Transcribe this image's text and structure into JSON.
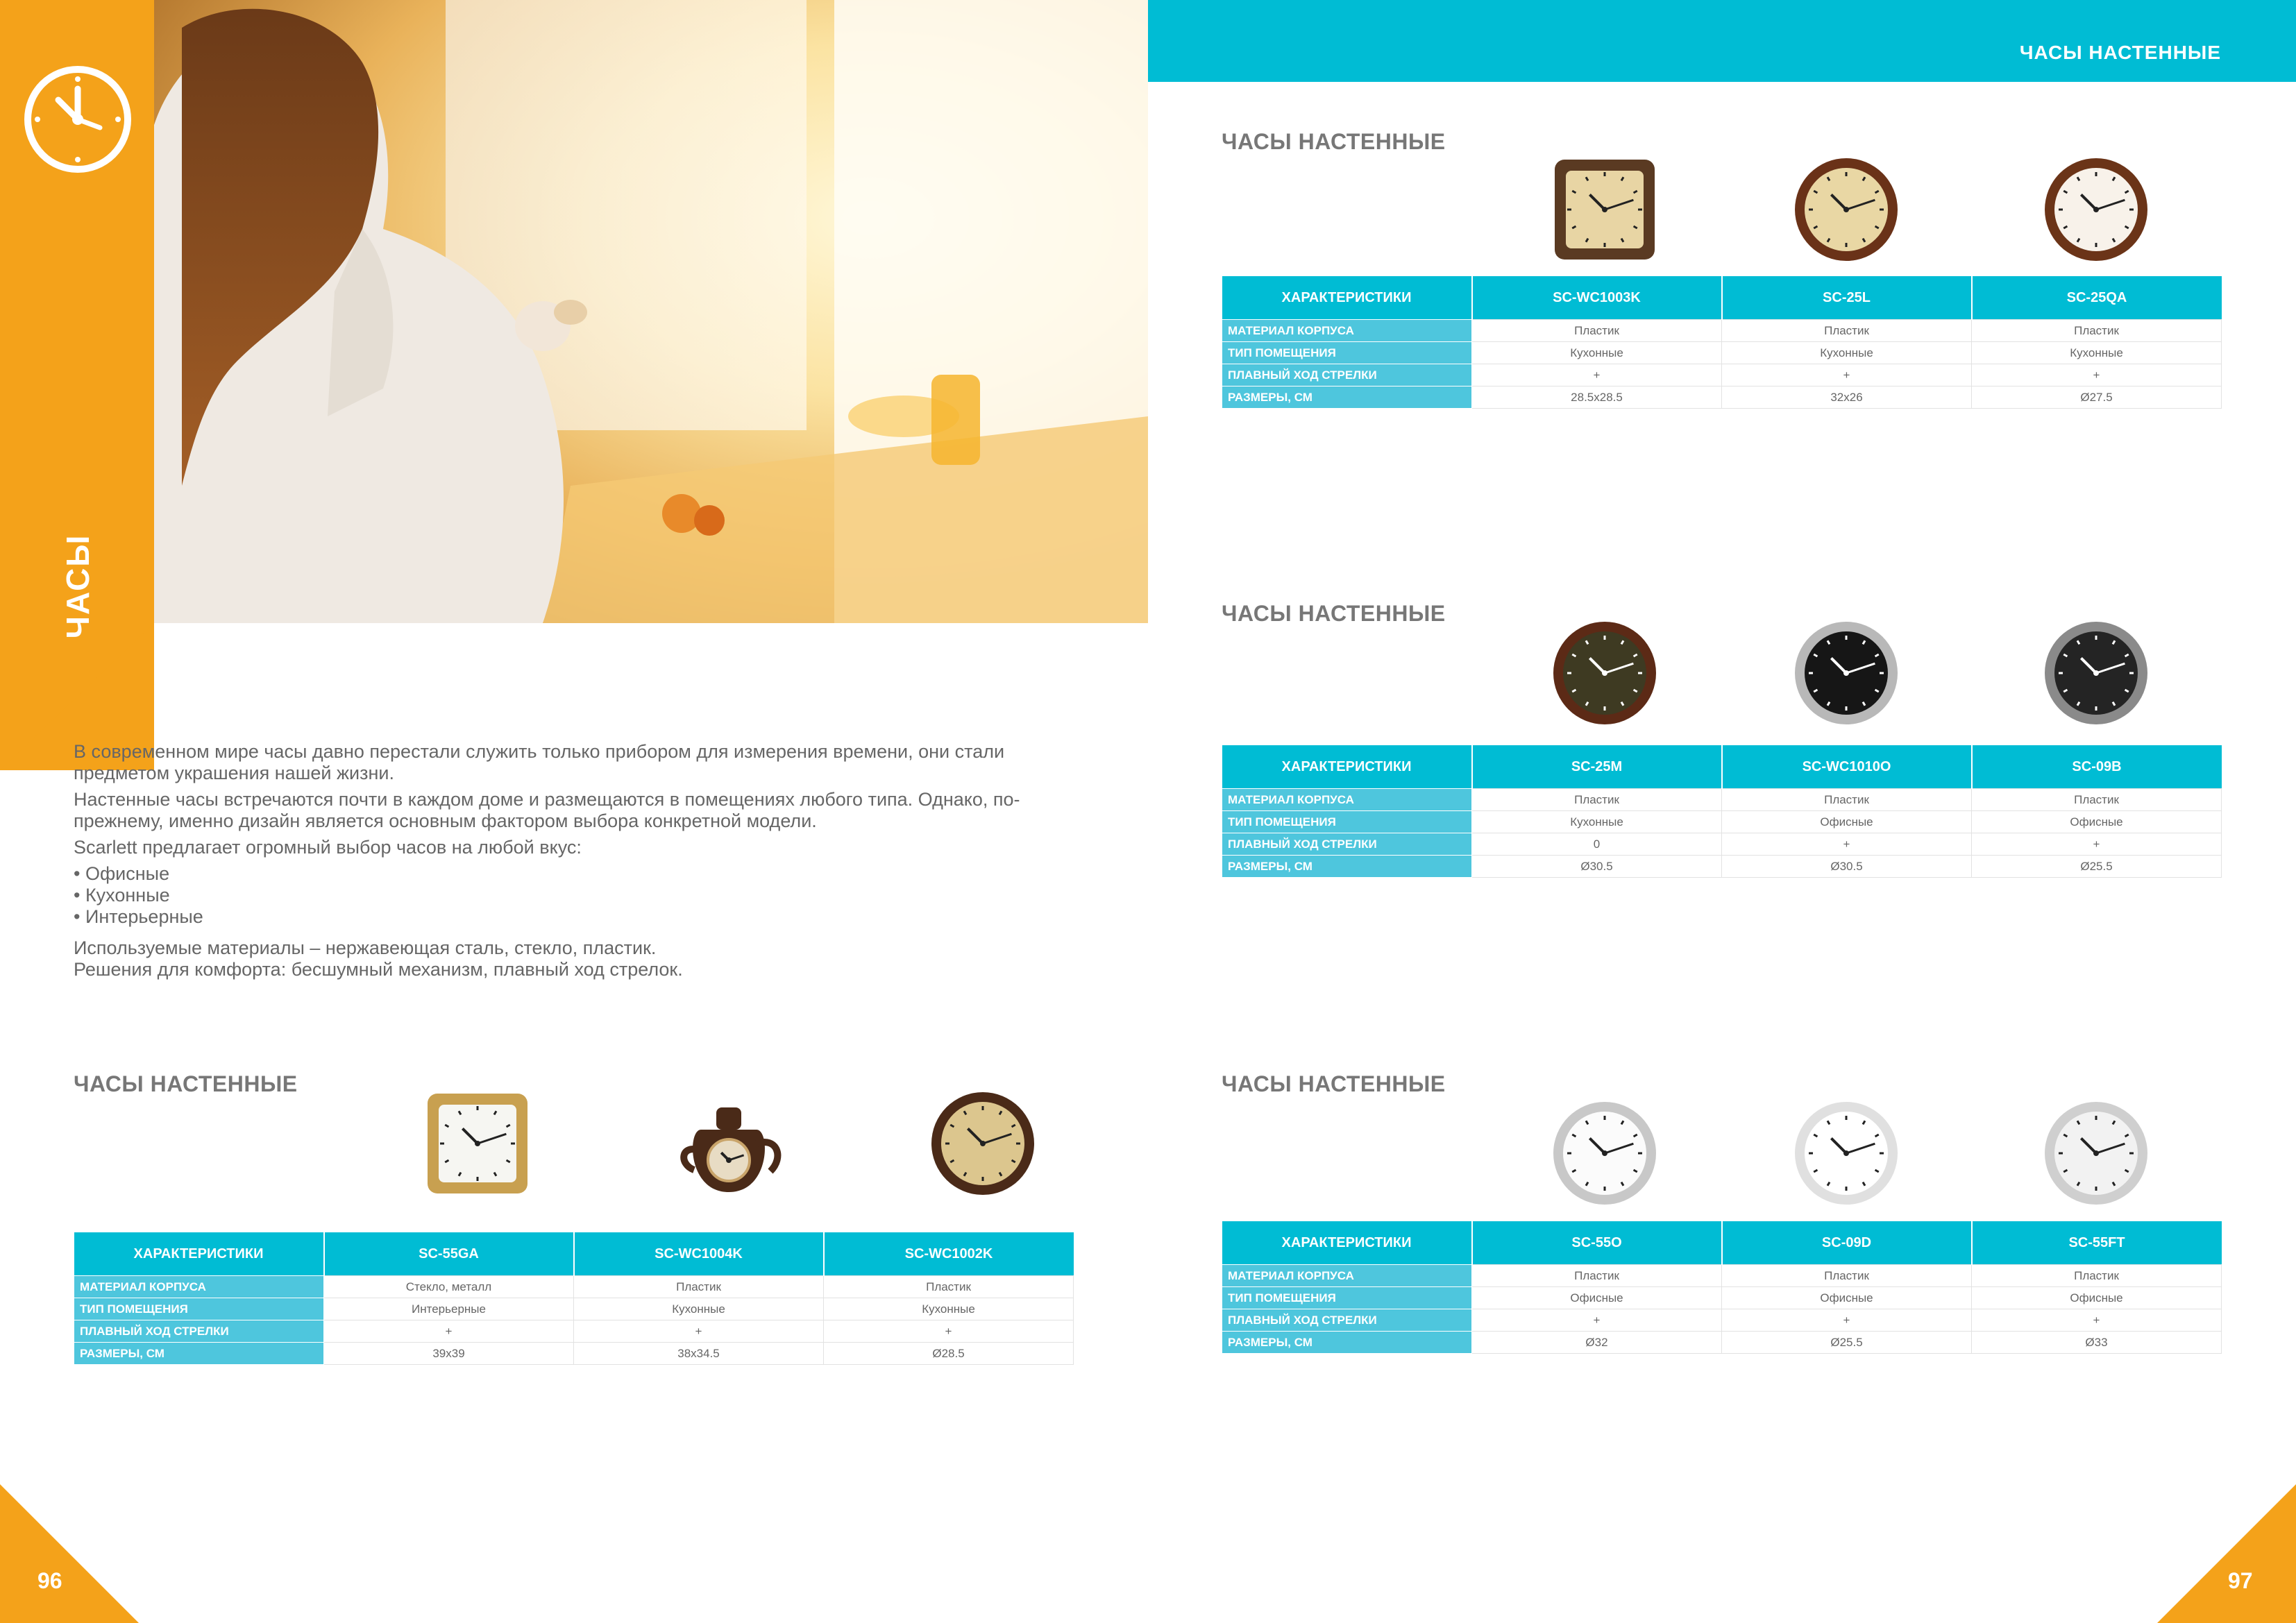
{
  "side": {
    "section_label": "ЧАСЫ"
  },
  "top_bar": {
    "title": "ЧАСЫ НАСТЕННЫЕ"
  },
  "intro": {
    "paragraph1": "В современном мире часы давно перестали служить только прибором для измерения времени, они стали предметом украшения нашей жизни.",
    "paragraph2": "Настенные часы встречаются почти в каждом доме и размещаются в помещениях любого типа. Однако, по-прежнему, именно дизайн является основным фактором выбора конкретной модели.",
    "paragraph3": "Scarlett предлагает огромный выбор часов на любой вкус:",
    "bullets": [
      "• Офисные",
      "• Кухонные",
      "• Интерьерные"
    ],
    "paragraph4": "Используемые материалы – нержавеющая сталь, стекло, пластик.",
    "paragraph5": "Решения для комфорта: бесшумный механизм, плавный ход стрелок."
  },
  "row_labels": [
    "МАТЕРИАЛ КОРПУСА",
    "ТИП ПОМЕЩЕНИЯ",
    "ПЛАВНЫЙ ХОД СТРЕЛКИ",
    "РАЗМЕРЫ, СМ"
  ],
  "blocks": [
    {
      "title": "ЧАСЫ НАСТЕННЫЕ",
      "header": "ХАРАКТЕРИСТИКИ",
      "models": [
        "SC-WC1003K",
        "SC-25L",
        "SC-25QA"
      ],
      "rows": [
        [
          "Пластик",
          "Пластик",
          "Пластик"
        ],
        [
          "Кухонные",
          "Кухонные",
          "Кухонные"
        ],
        [
          "+",
          "+",
          "+"
        ],
        [
          "28.5x28.5",
          "32x26",
          "Ø27.5"
        ]
      ]
    },
    {
      "title": "ЧАСЫ НАСТЕННЫЕ",
      "header": "ХАРАКТЕРИСТИКИ",
      "models": [
        "SC-25M",
        "SC-WC1010O",
        "SC-09B"
      ],
      "rows": [
        [
          "Пластик",
          "Пластик",
          "Пластик"
        ],
        [
          "Кухонные",
          "Офисные",
          "Офисные"
        ],
        [
          "0",
          "+",
          "+"
        ],
        [
          "Ø30.5",
          "Ø30.5",
          "Ø25.5"
        ]
      ]
    },
    {
      "title": "ЧАСЫ НАСТЕННЫЕ",
      "header": "ХАРАКТЕРИСТИКИ",
      "models": [
        "SC-55GA",
        "SC-WC1004K",
        "SC-WC1002K"
      ],
      "rows": [
        [
          "Стекло, металл",
          "Пластик",
          "Пластик"
        ],
        [
          "Интерьерные",
          "Кухонные",
          "Кухонные"
        ],
        [
          "+",
          "+",
          "+"
        ],
        [
          "39x39",
          "38x34.5",
          "Ø28.5"
        ]
      ]
    },
    {
      "title": "ЧАСЫ НАСТЕННЫЕ",
      "header": "ХАРАКТЕРИСТИКИ",
      "models": [
        "SC-55O",
        "SC-09D",
        "SC-55FT"
      ],
      "rows": [
        [
          "Пластик",
          "Пластик",
          "Пластик"
        ],
        [
          "Офисные",
          "Офисные",
          "Офисные"
        ],
        [
          "+",
          "+",
          "+"
        ],
        [
          "Ø32",
          "Ø25.5",
          "Ø33"
        ]
      ]
    }
  ],
  "page_left": "96",
  "page_right": "97",
  "colors": {
    "orange": "#f4a21a",
    "cyan": "#00bcd4",
    "cyan_light": "#4ec6dd"
  }
}
